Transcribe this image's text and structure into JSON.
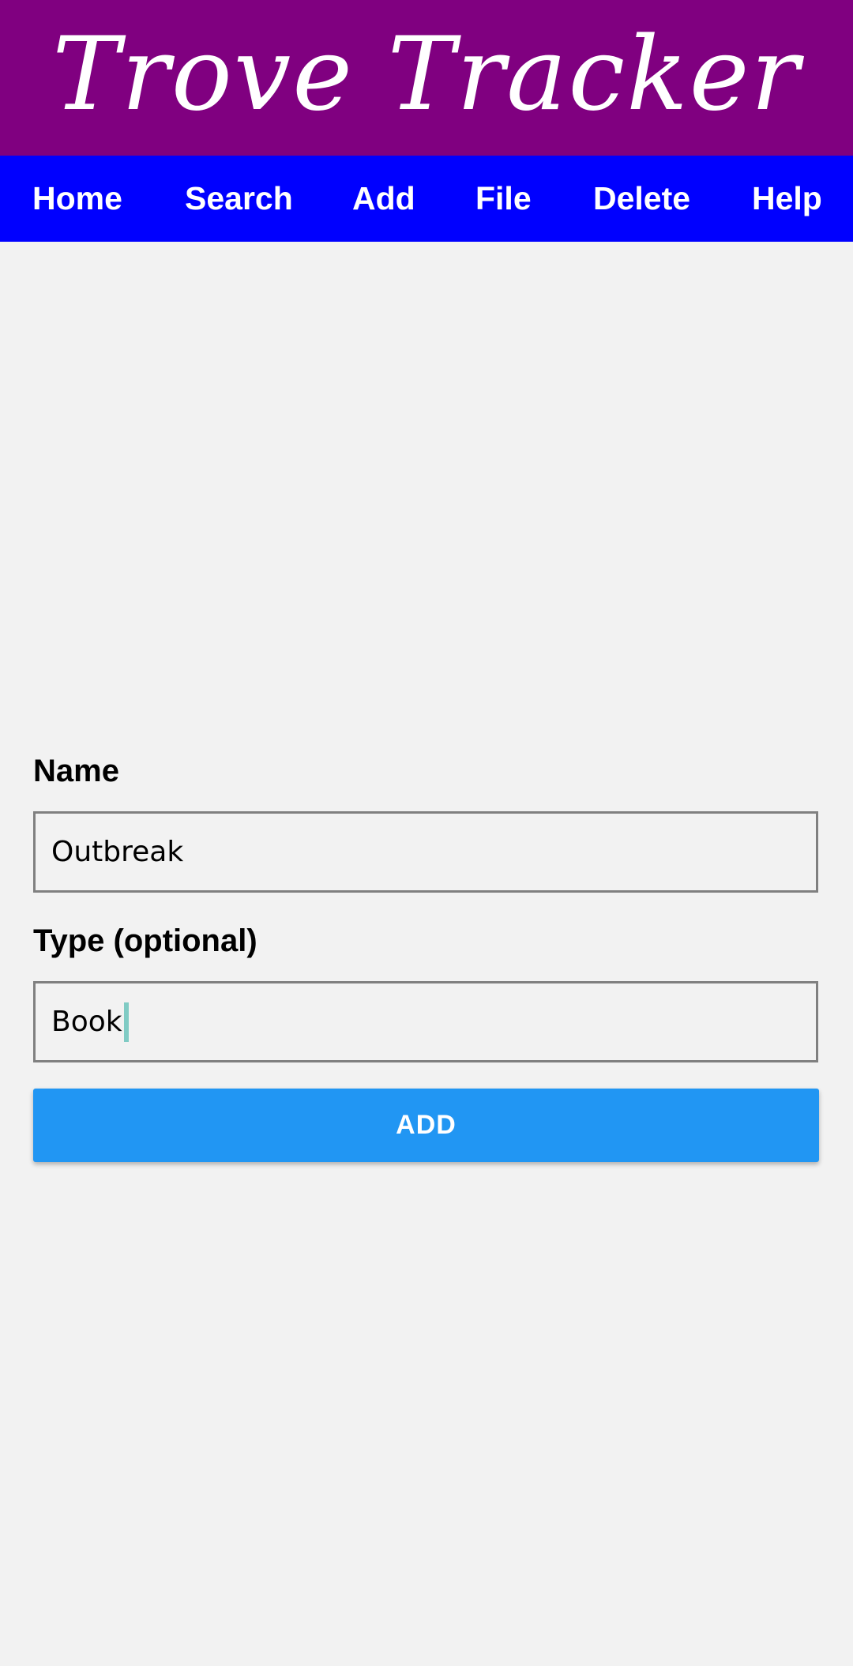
{
  "app": {
    "title": "Trove Tracker",
    "colors": {
      "title_bar": "#800080",
      "nav_bar": "#0000ff",
      "background": "#f2f2f2",
      "button": "#2196f3",
      "caret": "#80cbc4"
    }
  },
  "nav": {
    "items": [
      {
        "label": "Home"
      },
      {
        "label": "Search"
      },
      {
        "label": "Add"
      },
      {
        "label": "File"
      },
      {
        "label": "Delete"
      },
      {
        "label": "Help"
      }
    ]
  },
  "form": {
    "name": {
      "label": "Name",
      "value": "Outbreak"
    },
    "type": {
      "label": "Type (optional)",
      "value": "Book"
    },
    "submit_label": "ADD"
  }
}
